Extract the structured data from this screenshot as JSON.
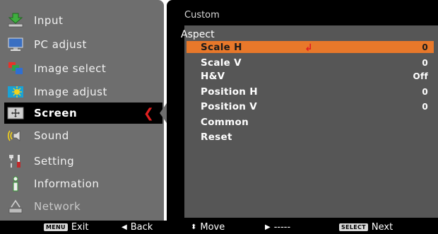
{
  "sidebar": {
    "items": [
      {
        "label": "Input",
        "icon": "input-icon"
      },
      {
        "label": "PC adjust",
        "icon": "monitor-icon"
      },
      {
        "label": "Image select",
        "icon": "image-select-icon"
      },
      {
        "label": "Image adjust",
        "icon": "image-adjust-icon"
      },
      {
        "label": "Screen",
        "icon": "screen-icon",
        "selected": true
      },
      {
        "label": "Sound",
        "icon": "speaker-icon"
      },
      {
        "label": "Setting",
        "icon": "setting-icon"
      },
      {
        "label": "Information",
        "icon": "information-icon"
      },
      {
        "label": "Network",
        "icon": "network-icon",
        "disabled": true
      }
    ]
  },
  "panel": {
    "header": "Custom",
    "section": "Aspect",
    "options": [
      {
        "name": "Scale H",
        "value": "0",
        "highlighted": true
      },
      {
        "name": "Scale V",
        "value": "0"
      },
      {
        "name": "H&V",
        "value": "Off"
      },
      {
        "name": "Position H",
        "value": "0"
      },
      {
        "name": "Position V",
        "value": "0"
      },
      {
        "name": "Common",
        "value": ""
      },
      {
        "name": "Reset",
        "value": ""
      }
    ]
  },
  "footer": {
    "exit_key": "MENU",
    "exit_label": "Exit",
    "back_label": "Back",
    "move_label": "Move",
    "blank_label": "-----",
    "select_key": "SELECT",
    "next_label": "Next"
  },
  "colors": {
    "highlight": "#e8782a",
    "selector": "#e02020",
    "sidebar_bg": "#6e6e6e",
    "panel_bg": "#565656"
  }
}
